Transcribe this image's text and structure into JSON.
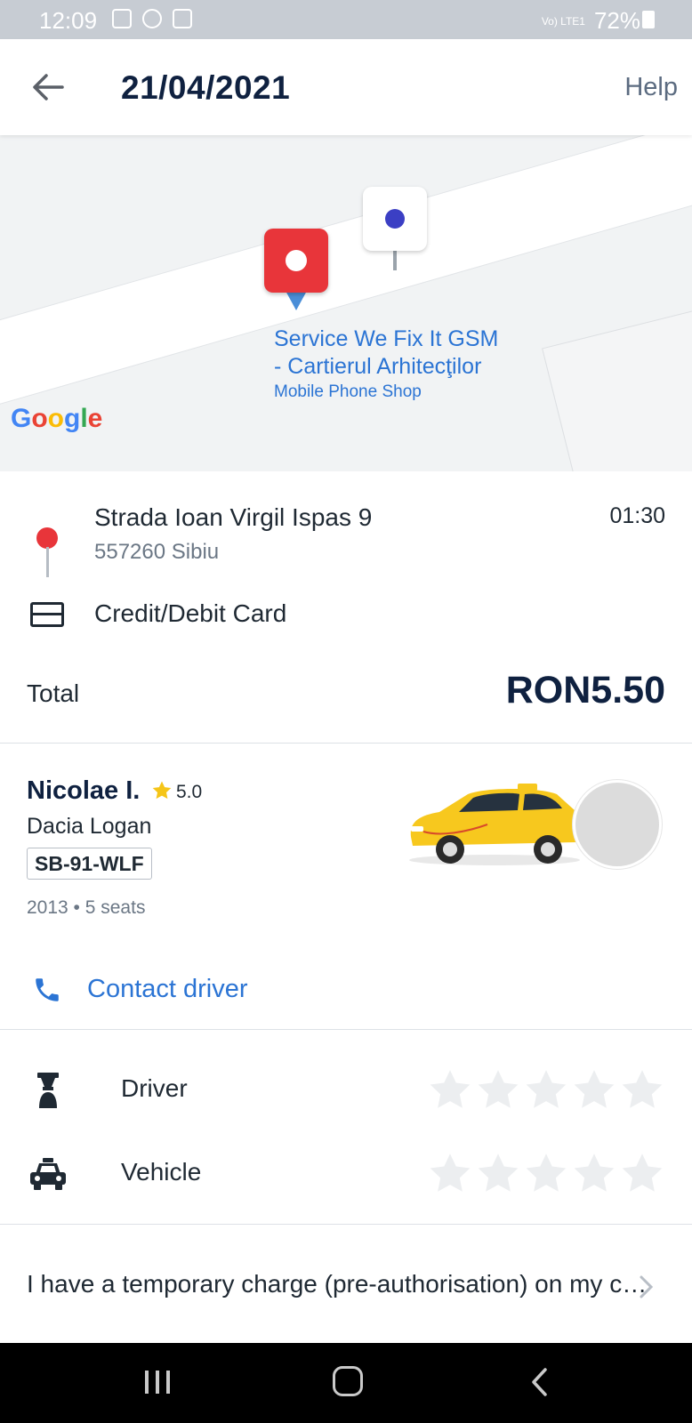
{
  "status_bar": {
    "time": "12:09",
    "signal_label": "Vo) LTE1",
    "battery": "72%"
  },
  "header": {
    "title": "21/04/2021",
    "help": "Help",
    "back_icon": "arrow-left-icon"
  },
  "map": {
    "poi_name_line1": "Service We Fix It GSM",
    "poi_name_line2": "- Cartierul Arhitecţilor",
    "poi_category": "Mobile Phone Shop",
    "attribution": [
      "G",
      "o",
      "o",
      "g",
      "l",
      "e"
    ]
  },
  "trip": {
    "address_line1": "Strada Ioan Virgil Ispas 9",
    "address_line2": "557260 Sibiu",
    "time": "01:30",
    "payment_method": "Credit/Debit Card",
    "total_label": "Total",
    "total_value": "RON5.50"
  },
  "driver": {
    "name": "Nicolae I.",
    "rating": "5.0",
    "car_model": "Dacia Logan",
    "plate": "SB-91-WLF",
    "car_meta": "2013 • 5 seats",
    "contact_label": "Contact driver"
  },
  "ratings": [
    {
      "label": "Driver",
      "icon": "driver-icon",
      "stars_filled": 0,
      "stars_total": 5
    },
    {
      "label": "Vehicle",
      "icon": "taxi-icon",
      "stars_filled": 0,
      "stars_total": 5
    }
  ],
  "faq": {
    "text": "I have a temporary charge (pre-authorisation) on my card"
  },
  "colors": {
    "accent_blue": "#2b74d4",
    "pin_red": "#e8353a",
    "taxi_yellow": "#f7c81e",
    "title_navy": "#0f2140"
  }
}
